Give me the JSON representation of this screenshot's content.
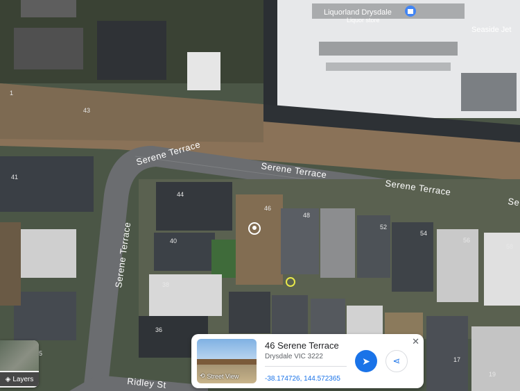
{
  "map": {
    "poi_name": "Liquorland Drysdale",
    "poi_category": "Liquor store",
    "poi_icon": "shopping-bag-icon",
    "poi_partial": "Seaside Jet",
    "roads": {
      "serene_a": "Serene Terrace",
      "serene_b": "Serene Terrace",
      "serene_c": "Serene Terrace",
      "serene_d": "Serene Terrace",
      "serene_edge": "Se",
      "ridley": "Ridley St"
    },
    "lots": {
      "l1": "1",
      "l43": "43",
      "l41": "41",
      "l44": "44",
      "l46": "46",
      "l48": "48",
      "l52": "52",
      "l54": "54",
      "l56": "56",
      "l58": "58",
      "l40": "40",
      "l38": "38",
      "l36": "36",
      "l17": "17",
      "l19": "19",
      "l5": "5"
    },
    "marker_icon": "place-marker-icon"
  },
  "layers": {
    "label": "Layers",
    "icon": "layers-icon"
  },
  "place_card": {
    "title": "46 Serene Terrace",
    "locality": "Drysdale VIC 3222",
    "coordinates": "-38.174726, 144.572365",
    "street_view_label": "Street View",
    "close_icon": "close-icon",
    "directions_icon": "directions-icon",
    "share_icon": "share-icon",
    "accent": "#1a73e8"
  }
}
